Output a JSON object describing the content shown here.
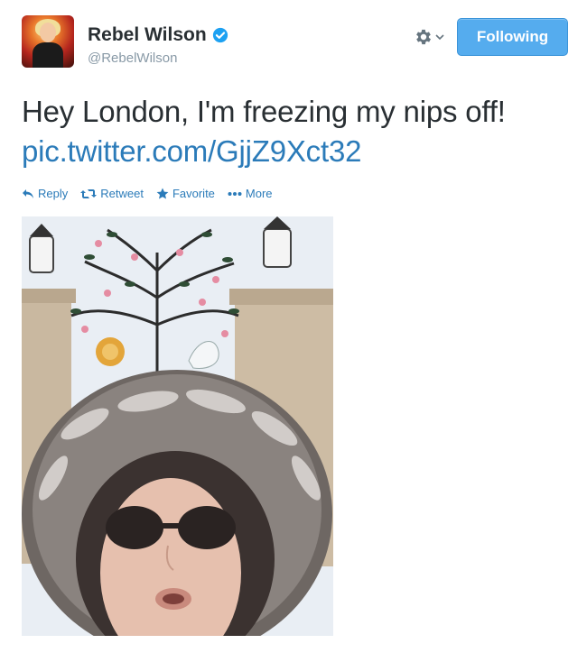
{
  "user": {
    "name": "Rebel Wilson",
    "handle": "@RebelWilson"
  },
  "follow_button": {
    "label": "Following"
  },
  "tweet": {
    "text": "Hey London, I'm freezing my nips off!",
    "link": "pic.twitter.com/GjjZ9Xct32"
  },
  "actions": {
    "reply": "Reply",
    "retweet": "Retweet",
    "favorite": "Favorite",
    "more": "More"
  },
  "colors": {
    "link": "#2b7bb9",
    "button": "#55acee",
    "verified": "#1da1f2"
  },
  "icons": [
    "avatar",
    "verified-badge-icon",
    "gear-icon",
    "chevron-down-icon",
    "reply-icon",
    "retweet-icon",
    "star-icon",
    "more-dots-icon"
  ]
}
